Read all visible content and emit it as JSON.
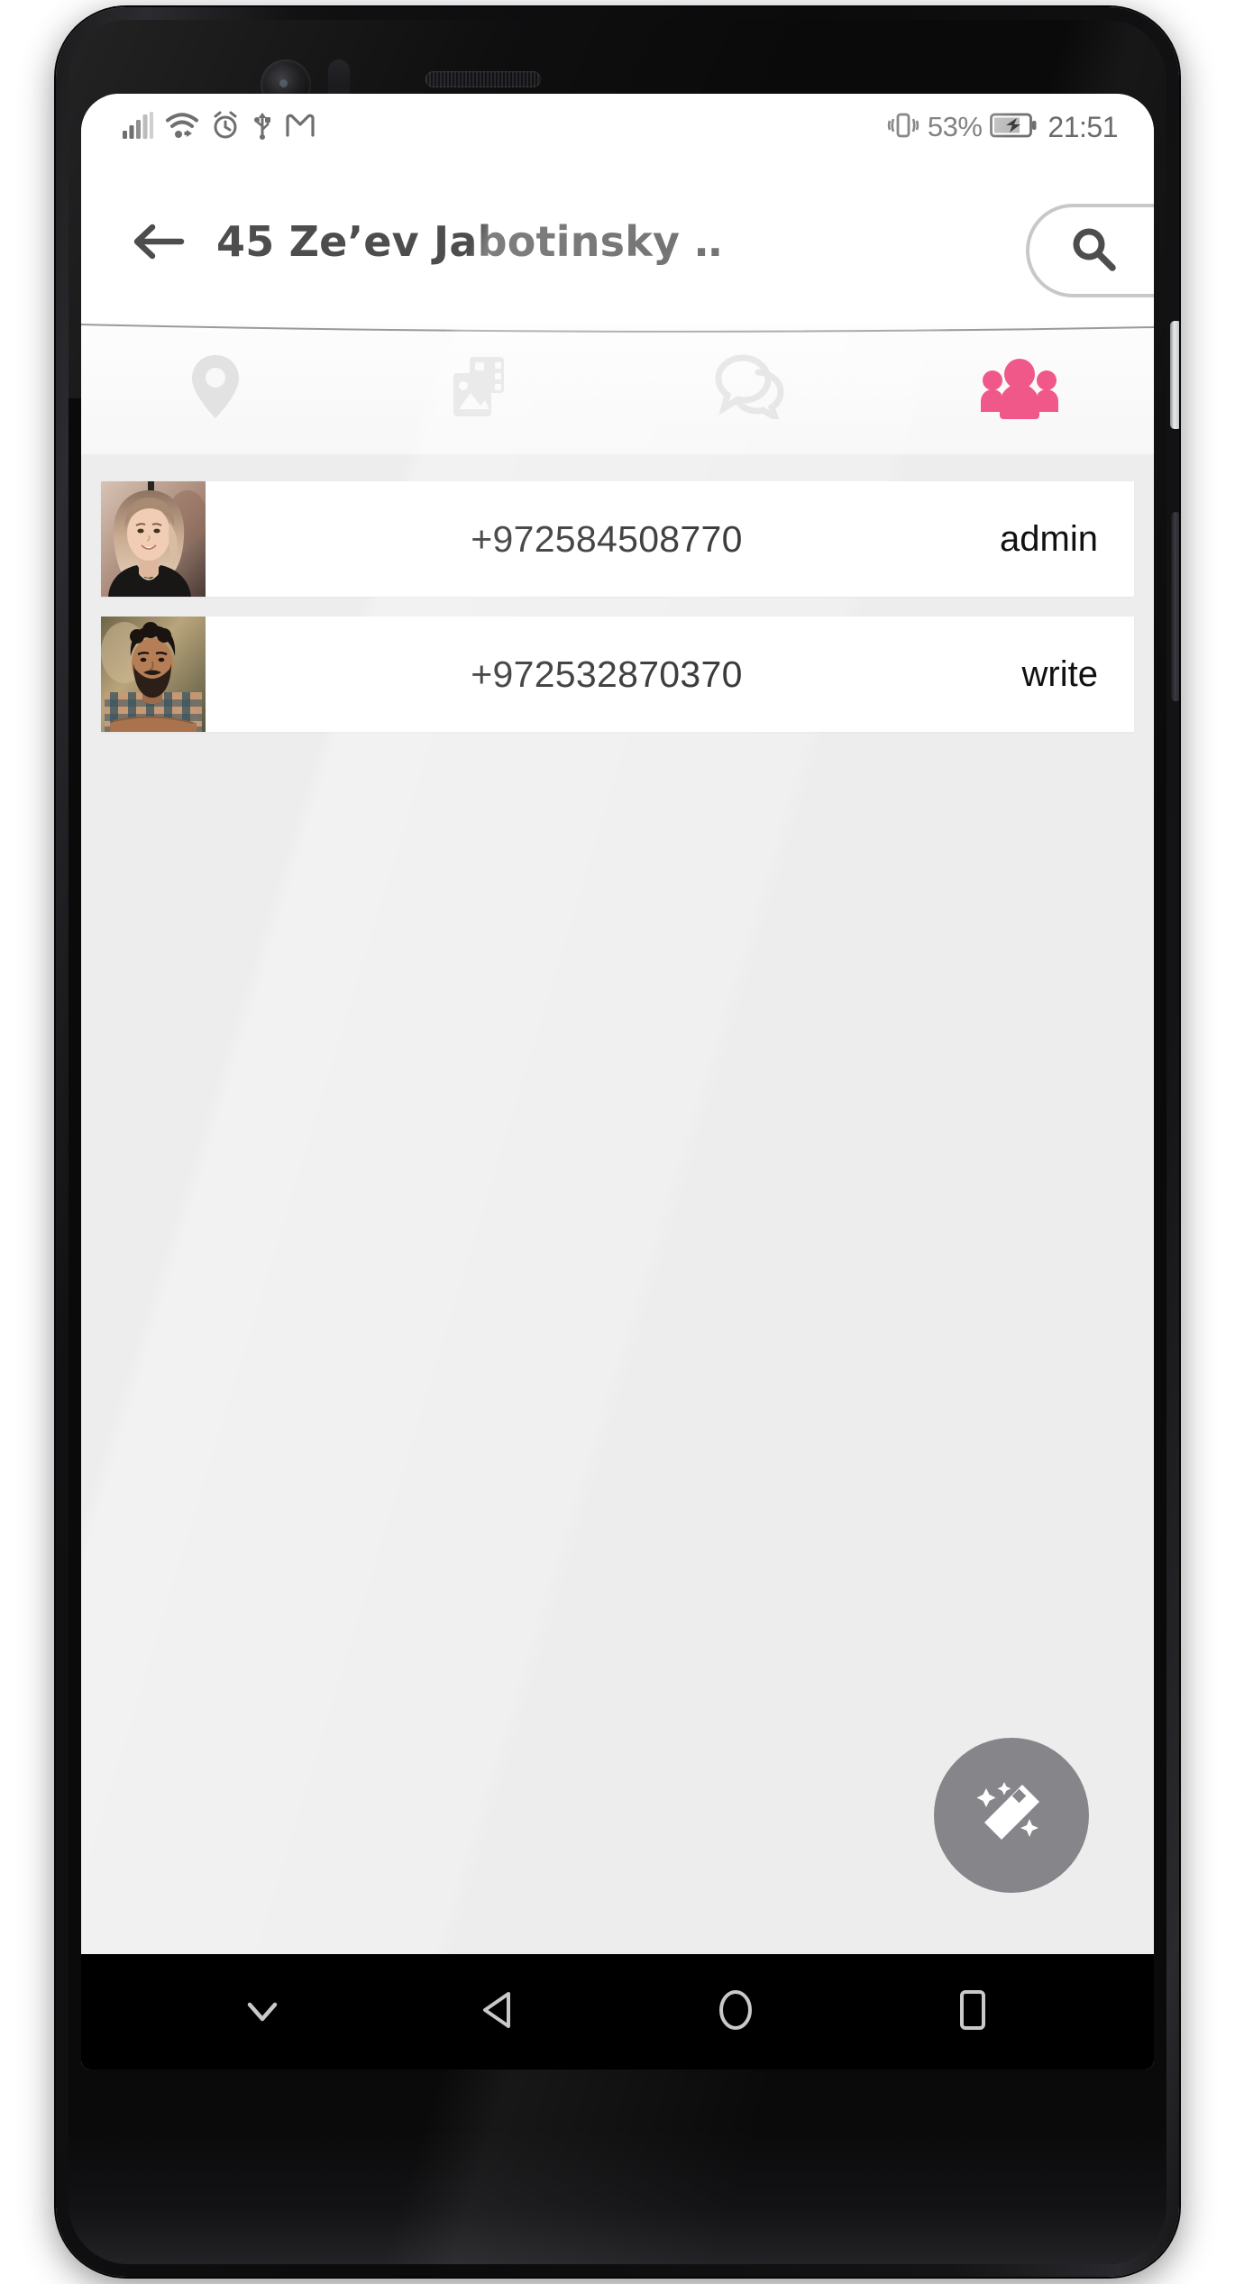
{
  "status_bar": {
    "icons_left": [
      "signal-bars-icon",
      "wifi-icon",
      "alarm-icon",
      "usb-icon",
      "gmail-icon"
    ],
    "vibrate_icon": "vibrate-icon",
    "battery_percent": "53%",
    "battery_icon": "battery-charging-icon",
    "clock": "21:51"
  },
  "app_bar": {
    "back_icon": "arrow-left-icon",
    "title": "45 Ze’ev Jabotinsky …",
    "search_icon": "search-icon"
  },
  "tabs": [
    {
      "name": "location",
      "icon": "map-pin-icon",
      "active": false
    },
    {
      "name": "media",
      "icon": "photo-gallery-icon",
      "active": false
    },
    {
      "name": "chat",
      "icon": "chat-bubbles-icon",
      "active": false
    },
    {
      "name": "members",
      "icon": "people-group-icon",
      "active": true
    }
  ],
  "members": [
    {
      "avatar": "woman-portrait-avatar",
      "phone": "+972584508770",
      "role": "admin"
    },
    {
      "avatar": "man-portrait-avatar",
      "phone": "+972532870370",
      "role": "write"
    }
  ],
  "fab": {
    "icon": "magic-wand-icon",
    "color": "#85858a"
  },
  "nav_bar": {
    "buttons": [
      {
        "name": "hide-keyboard",
        "icon": "chevron-down-icon"
      },
      {
        "name": "back",
        "icon": "triangle-back-icon"
      },
      {
        "name": "home",
        "icon": "circle-home-icon"
      },
      {
        "name": "recents",
        "icon": "square-recents-icon"
      }
    ]
  },
  "colors": {
    "accent_pink": "#f0588a",
    "tab_inactive": "#e2e2e2",
    "screen_bg": "#ededed",
    "card_bg": "#ffffff",
    "app_bar_text": "#4d4d4d",
    "status_text": "#6b6b6b"
  }
}
